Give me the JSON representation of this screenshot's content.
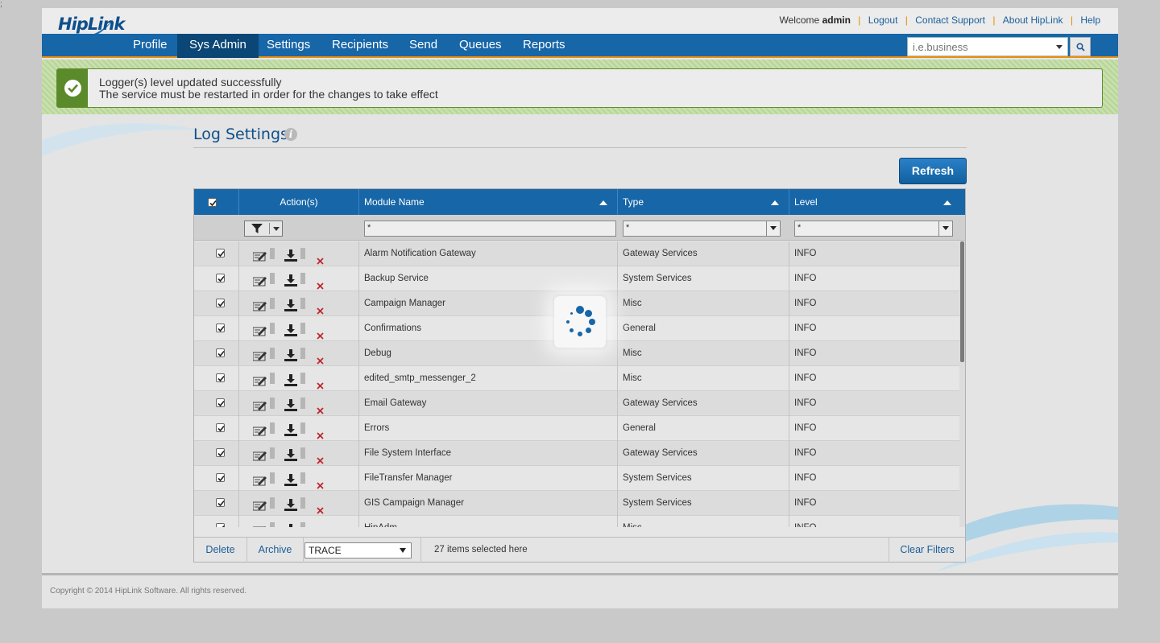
{
  "app": {
    "logo_text": "HipLink",
    "corner_mark": ";"
  },
  "top_links": {
    "welcome_prefix": "Welcome",
    "username": "admin",
    "logout": "Logout",
    "contact": "Contact Support",
    "about": "About HipLink",
    "help": "Help"
  },
  "nav": [
    {
      "label": "Profile"
    },
    {
      "label": "Sys Admin",
      "active": true
    },
    {
      "label": "Settings"
    },
    {
      "label": "Recipients"
    },
    {
      "label": "Send"
    },
    {
      "label": "Queues"
    },
    {
      "label": "Reports"
    }
  ],
  "search": {
    "placeholder": "i.e.business"
  },
  "alert": {
    "line1": "Logger(s) level updated successfully",
    "line2": "The service must be restarted in order for the changes to take effect"
  },
  "page": {
    "title": "Log Settings",
    "info_glyph": "i",
    "refresh_label": "Refresh"
  },
  "grid": {
    "columns": {
      "actions": "Action(s)",
      "module": "Module Name",
      "type": "Type",
      "level": "Level"
    },
    "filters": {
      "module": "*",
      "type": "*",
      "level": "*"
    },
    "rows": [
      {
        "module": "Alarm Notification Gateway",
        "type": "Gateway Services",
        "level": "INFO"
      },
      {
        "module": "Backup Service",
        "type": "System Services",
        "level": "INFO"
      },
      {
        "module": "Campaign Manager",
        "type": "Misc",
        "level": "INFO"
      },
      {
        "module": "Confirmations",
        "type": "General",
        "level": "INFO"
      },
      {
        "module": "Debug",
        "type": "Misc",
        "level": "INFO"
      },
      {
        "module": "edited_smtp_messenger_2",
        "type": "Misc",
        "level": "INFO"
      },
      {
        "module": "Email Gateway",
        "type": "Gateway Services",
        "level": "INFO"
      },
      {
        "module": "Errors",
        "type": "General",
        "level": "INFO"
      },
      {
        "module": "File System Interface",
        "type": "Gateway Services",
        "level": "INFO"
      },
      {
        "module": "FileTransfer Manager",
        "type": "System Services",
        "level": "INFO"
      },
      {
        "module": "GIS Campaign Manager",
        "type": "System Services",
        "level": "INFO"
      },
      {
        "module": "HipAdm",
        "type": "Misc",
        "level": "INFO"
      }
    ],
    "footer": {
      "delete": "Delete",
      "archive": "Archive",
      "level_select": "TRACE",
      "selection_status": "27 items selected here",
      "clear_filters": "Clear Filters"
    }
  },
  "copyright": "Copyright © 2014 HipLink Software. All rights reserved.",
  "colors": {
    "nav_blue": "#1666a8",
    "nav_active": "#0b4776",
    "accent_orange": "#f0900a",
    "success_green": "#5a8a2a",
    "delete_red": "#c0272d"
  }
}
